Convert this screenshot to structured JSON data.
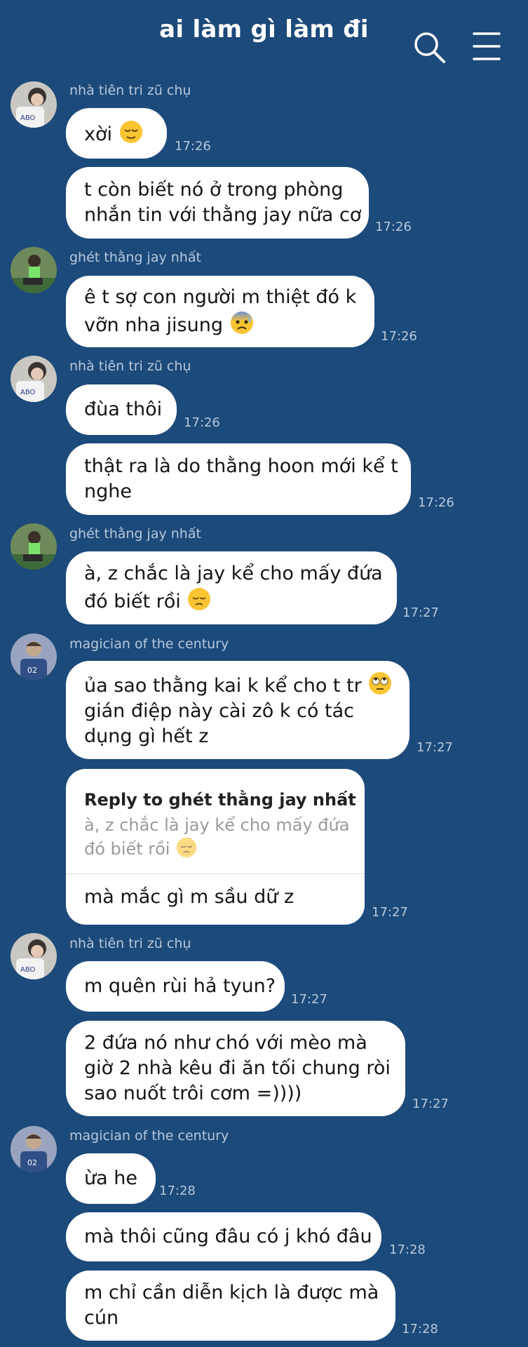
{
  "header": {
    "title": "ai làm gì làm đi",
    "search_icon": "search-icon",
    "menu_icon": "menu-icon"
  },
  "colors": {
    "background": "#1c4a7a",
    "bubble": "#ffffff",
    "meta_text": "#b8c8dc"
  },
  "messages": [
    {
      "sender": "nhà tiên tri zũ chụ",
      "lines": [
        "xời"
      ],
      "emoji": "relieved-face-icon",
      "time": "17:26"
    },
    {
      "lines": [
        "t còn biết nó ở trong phòng",
        "nhắn tin với thằng jay nữa cơ"
      ],
      "time": "17:26"
    },
    {
      "sender": "ghét thằng jay nhất",
      "lines": [
        "ê t sợ con người m thiệt đó k",
        "vỡn nha jisung"
      ],
      "emoji": "anxious-face-icon",
      "time": "17:26"
    },
    {
      "sender": "nhà tiên tri zũ chụ",
      "lines": [
        "đùa thôi"
      ],
      "time": "17:26"
    },
    {
      "lines": [
        "thật ra là do thằng hoon mới kể t",
        "nghe"
      ],
      "time": "17:26"
    },
    {
      "sender": "ghét thằng jay nhất",
      "lines": [
        "à, z chắc là jay kể cho mấy đứa",
        "đó biết rồi"
      ],
      "emoji": "pensive-face-icon",
      "time": "17:27"
    },
    {
      "sender": "magician of the century",
      "lines": [
        "ủa sao thằng kai k kể cho t tr",
        "gián điệp này cài zô k có tác",
        "dụng gì hết z"
      ],
      "emoji": "eye-roll-face-icon",
      "time": "17:27"
    },
    {
      "reply_header": "Reply to ghét thằng jay nhất",
      "reply_quote": [
        "à, z chắc là jay kể cho mấy đứa",
        "đó biết rồi"
      ],
      "lines": [
        "mà mắc gì m sầu dữ z"
      ],
      "time": "17:27"
    },
    {
      "sender": "nhà tiên tri zũ chụ",
      "lines": [
        "m quên rùi hả tyun?"
      ],
      "time": "17:27"
    },
    {
      "lines": [
        "2 đứa nó như chó với mèo mà",
        "giờ 2 nhà kêu đi ăn tối chung ròi",
        "sao nuốt trôi cơm =))))"
      ],
      "time": "17:27"
    },
    {
      "sender": "magician of the century",
      "lines": [
        "ừa he"
      ],
      "time": "17:28"
    },
    {
      "lines": [
        "mà thôi cũng đâu có j khó đâu"
      ],
      "time": "17:28"
    },
    {
      "lines": [
        "m chỉ cần diễn kịch là được mà",
        "cún"
      ],
      "time": "17:28"
    }
  ]
}
